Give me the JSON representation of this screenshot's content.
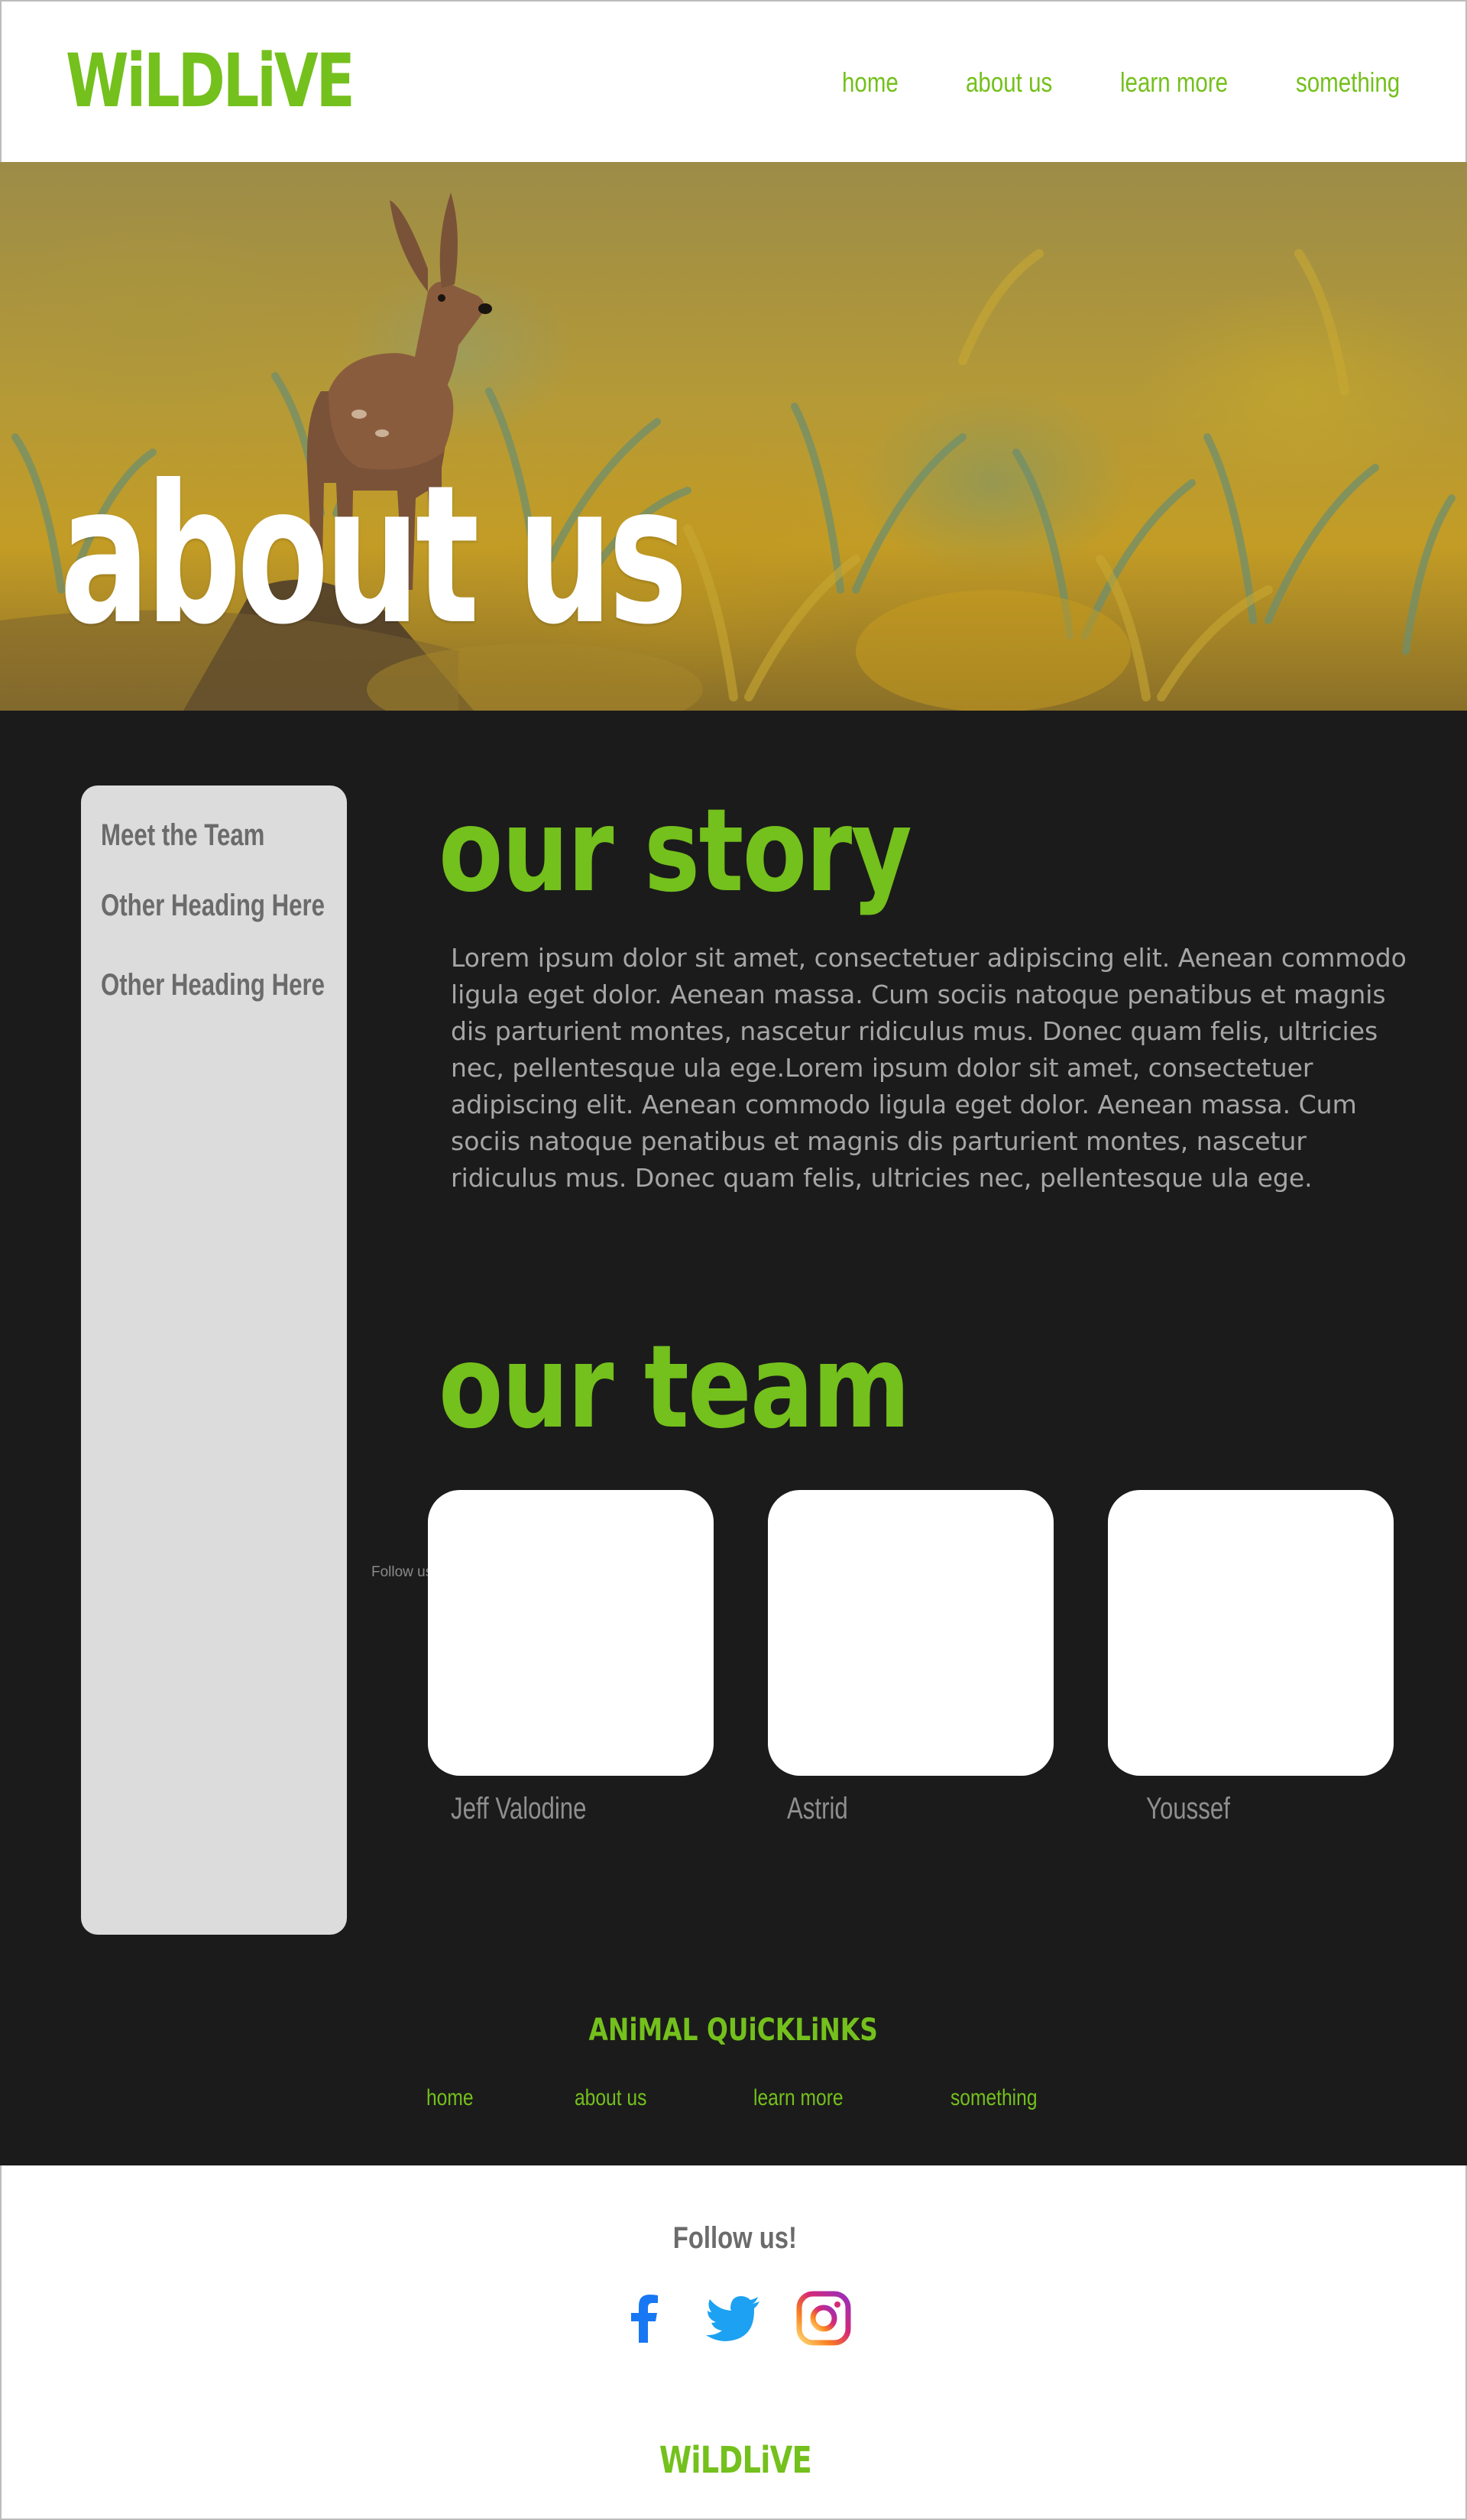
{
  "header": {
    "logo": "WiLDLiVE",
    "nav": [
      "home",
      "about us",
      "learn more",
      "something"
    ]
  },
  "hero": {
    "title": "about us"
  },
  "sidebar": {
    "items": [
      "Meet the Team",
      "Other Heading Here",
      "Other Heading Here"
    ]
  },
  "story": {
    "heading": "our story",
    "body": "Lorem ipsum dolor sit amet, consectetuer adipiscing elit. Aenean commodo ligula eget dolor. Aenean massa. Cum sociis natoque penatibus et magnis dis parturient montes, nascetur ridiculus mus. Donec quam felis, ultricies nec, pellentesque ula ege.Lorem ipsum dolor sit amet, consectetuer adipiscing elit. Aenean commodo ligula eget dolor. Aenean massa. Cum sociis natoque penatibus et magnis dis parturient montes, nascetur ridiculus mus. Donec quam felis, ultricies nec, pellentesque ula ege."
  },
  "team": {
    "heading": "our team",
    "overlay_text": "Follow us!",
    "members": [
      "Jeff Valodine",
      "Astrid",
      "Youssef"
    ]
  },
  "quicklinks": {
    "title": "ANiMAL QUiCKLiNKS",
    "links": [
      "home",
      "about us",
      "learn more",
      "something"
    ]
  },
  "footer": {
    "follow_label": "Follow us!",
    "social_icons": [
      "facebook-icon",
      "twitter-icon",
      "instagram-icon"
    ],
    "logo": "WiLDLiVE"
  },
  "colors": {
    "brand_green": "#74C01C",
    "dark_bg": "#1B1B1B",
    "sidebar_bg": "#DCDCDC",
    "facebook": "#1877F2",
    "twitter": "#1DA1F2"
  }
}
